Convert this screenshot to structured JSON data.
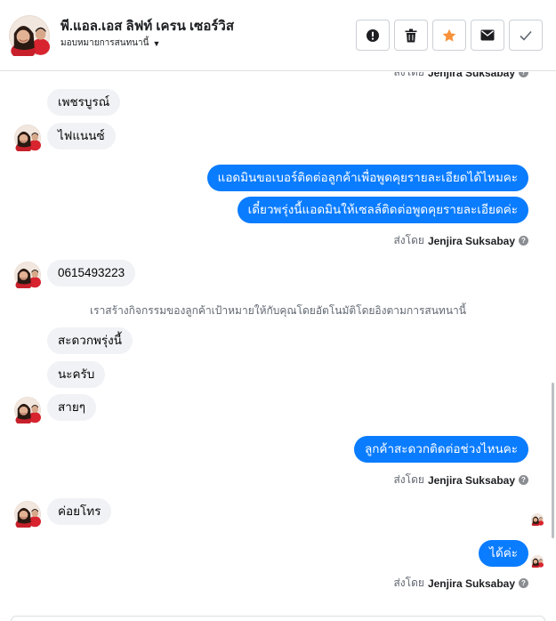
{
  "header": {
    "title": "พี.แอล.เอส ลิฟท์ เครน เซอร์วิส",
    "subtitle": "มอบหมายการสนทนานี้",
    "actions": [
      {
        "icon": "alert-icon",
        "label": "Mark as spam"
      },
      {
        "icon": "trash-icon",
        "label": "Delete"
      },
      {
        "icon": "star-icon",
        "label": "Star"
      },
      {
        "icon": "envelope-icon",
        "label": "Mark as unread"
      },
      {
        "icon": "checkmark-icon",
        "label": "Mark as done"
      }
    ]
  },
  "thread": {
    "messages": [
      {
        "direction": "in",
        "text": "เพชรบูรณ์"
      },
      {
        "direction": "in",
        "text": "ไฟแนนซ์"
      },
      {
        "direction": "out",
        "text": "แอดมินขอเบอร์ติดต่อลูกค้าเพื่อพูดคุยรายละเอียดได้ไหมคะ"
      },
      {
        "direction": "out",
        "text": "เดี๋ยวพรุ่งนี้แอดมินให้เซลล์ติดต่อพูดคุยรายละเอียดค่ะ"
      },
      {
        "direction": "in",
        "text": "0615493223"
      },
      {
        "direction": "in",
        "text": "สะดวกพรุ่งนี้"
      },
      {
        "direction": "in",
        "text": "นะครับ"
      },
      {
        "direction": "in",
        "text": "สายๆ"
      },
      {
        "direction": "out",
        "text": "ลูกค้าสะดวกติดต่อช่วงไหนคะ"
      },
      {
        "direction": "in",
        "text": "ค่อยโทร"
      },
      {
        "direction": "out",
        "text": "ได้ค่ะ"
      }
    ],
    "sent_by_prefix": "ส่งโดย",
    "sent_by_name": "Jenjira Suksabay",
    "system_note": "เราสร้างกิจกรรมของลูกค้าเป้าหมายให้กับคุณโดยอัตโนมัติโดยอิงตามการสนทนานี้"
  },
  "colors": {
    "outgoing_bubble": "#0a7cff",
    "incoming_bubble": "#f0f2f5",
    "star_accent": "#f7923b",
    "avatar_shirt": "#d8242f"
  }
}
